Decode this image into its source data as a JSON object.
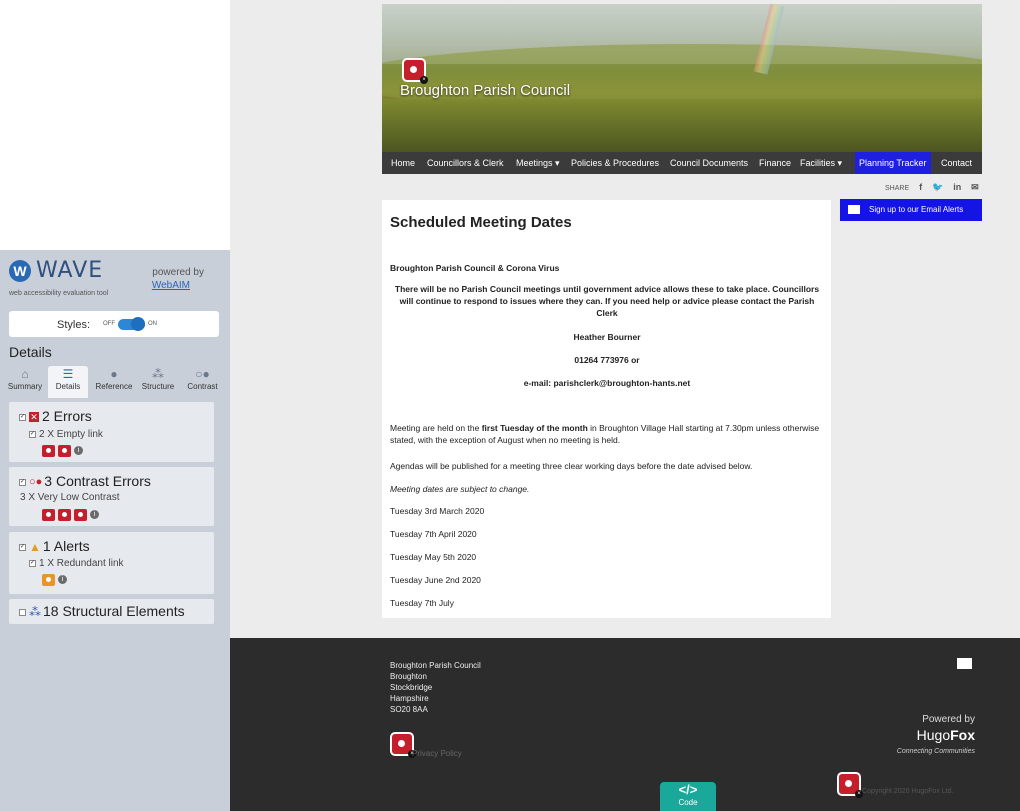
{
  "wave": {
    "name": "WAVE",
    "tagline": "web accessibility evaluation tool",
    "powered_by": "powered by",
    "webaim": "WebAIM",
    "styles_label": "Styles:",
    "styles_off": "OFF",
    "styles_on": "ON",
    "details_title": "Details",
    "tabs": [
      {
        "label": "Summary",
        "icon": "home-icon"
      },
      {
        "label": "Details",
        "icon": "list-icon"
      },
      {
        "label": "Reference",
        "icon": "info-icon"
      },
      {
        "label": "Structure",
        "icon": "structure-icon"
      },
      {
        "label": "Contrast",
        "icon": "contrast-icon"
      }
    ],
    "active_tab": "Details",
    "errors": {
      "heading": "2 Errors",
      "item": "2 X Empty link"
    },
    "contrast": {
      "heading": "3 Contrast Errors",
      "item": "3 X Very Low Contrast"
    },
    "alerts": {
      "heading": "1 Alerts",
      "item": "1 X Redundant link"
    },
    "structural": {
      "heading": "18 Structural Elements"
    },
    "colors": {
      "error": "#c41f2b",
      "alert": "#e8952c",
      "accent": "#2d86d6"
    }
  },
  "site": {
    "title": "Broughton Parish Council",
    "nav": [
      "Home",
      "Councillors & Clerk",
      "Meetings ▾",
      "Policies & Procedures",
      "Council Documents",
      "Finance",
      "Facilities ▾",
      "Planning Tracker",
      "Contact"
    ],
    "active_nav": "Planning Tracker",
    "share_label": "SHARE",
    "signup": "Sign up to our Email Alerts",
    "content": {
      "title": "Scheduled Meeting Dates",
      "subhead": "Broughton Parish Council & Corona Virus",
      "notice": "There will be no Parish Council meetings until government advice allows these to take place. Councillors will continue to respond to issues where they can. If you need help or advice please contact the Parish Clerk",
      "clerk": "Heather Bourner",
      "phone": "01264 773976 or",
      "email": "e-mail: parishclerk@broughton-hants.net",
      "meeting_pre": "Meeting are held on the ",
      "meeting_bold": "first Tuesday of the month",
      "meeting_post": " in Broughton Village Hall starting at 7.30pm unless otherwise stated, with the exception of August when no meeting is held.",
      "agendas": "Agendas will be published for a meeting three clear working days before the date advised below.",
      "subject": "Meeting dates are subject to change.",
      "dates": [
        "Tuesday 3rd March 2020",
        "Tuesday 7th April 2020",
        "Tuesday May 5th 2020",
        "Tuesday June 2nd 2020",
        "Tuesday 7th July"
      ]
    },
    "footer": {
      "address": [
        "Broughton Parish Council",
        "Broughton",
        "Stockbridge",
        "Hampshire",
        "SO20 8AA"
      ],
      "privacy": "Privacy Policy",
      "powered_by": "Powered by",
      "brand_light": "Hugo",
      "brand_bold": "Fox",
      "slogan": "Connecting Communities",
      "copyright": "Copyright 2020 HugoFox Ltd."
    },
    "code_button": {
      "glyph": "</>",
      "label": "Code"
    }
  }
}
